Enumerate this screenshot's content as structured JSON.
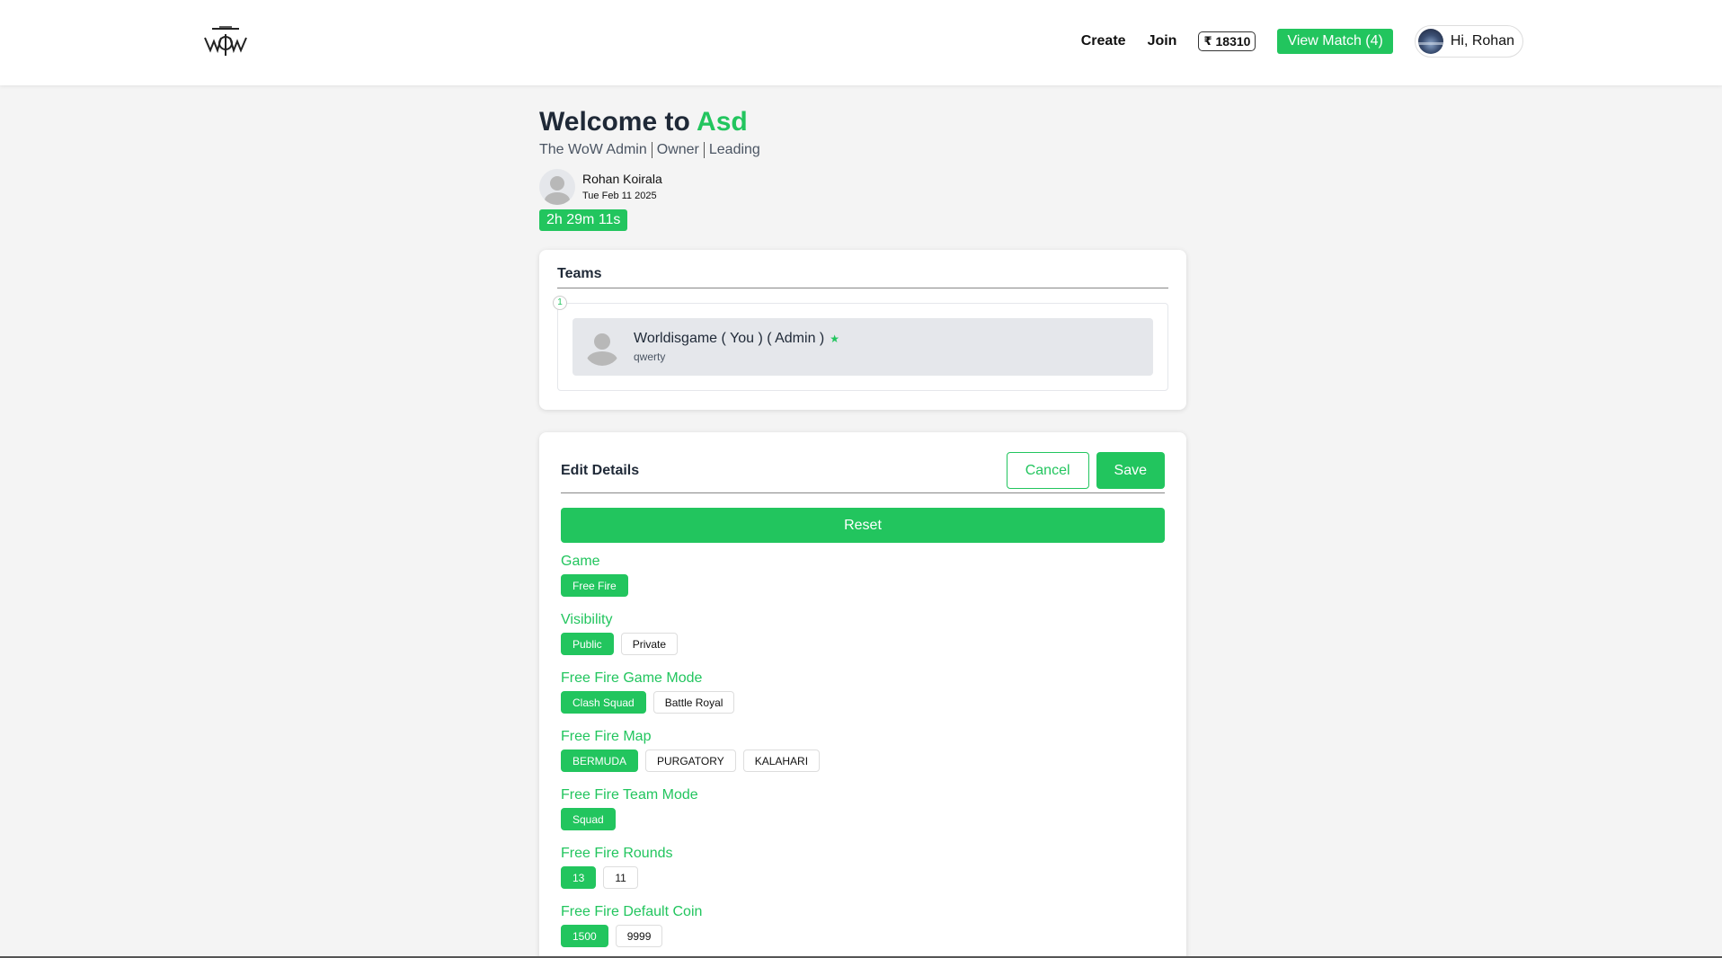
{
  "header": {
    "logo_text": "WOW",
    "nav": {
      "create": "Create",
      "join": "Join",
      "coin_symbol": "₹",
      "coins": "18310",
      "view_match": "View Match (4)",
      "greeting": "Hi, Rohan"
    }
  },
  "welcome": {
    "title_prefix": "Welcome to",
    "title_accent": "Asd",
    "roles": [
      "The WoW Admin",
      "Owner",
      "Leading"
    ],
    "creator_name": "Rohan Koirala",
    "creator_date": "Tue Feb 11 2025",
    "timer": "2h 29m 11s"
  },
  "teams": {
    "heading": "Teams",
    "items": [
      {
        "number": "1",
        "name": "Worldisgame ( You ) ( Admin )",
        "subtitle": "qwerty"
      }
    ]
  },
  "edit": {
    "heading": "Edit Details",
    "cancel": "Cancel",
    "save": "Save",
    "reset": "Reset",
    "fields": [
      {
        "label": "Game",
        "options": [
          "Free Fire"
        ],
        "selected": 0
      },
      {
        "label": "Visibility",
        "options": [
          "Public",
          "Private"
        ],
        "selected": 0
      },
      {
        "label": "Free Fire Game Mode",
        "options": [
          "Clash Squad",
          "Battle Royal"
        ],
        "selected": 0
      },
      {
        "label": "Free Fire Map",
        "options": [
          "BERMUDA",
          "PURGATORY",
          "KALAHARI"
        ],
        "selected": 0
      },
      {
        "label": "Free Fire Team Mode",
        "options": [
          "Squad"
        ],
        "selected": 0
      },
      {
        "label": "Free Fire Rounds",
        "options": [
          "13",
          "11"
        ],
        "selected": 0
      },
      {
        "label": "Free Fire Default Coin",
        "options": [
          "1500",
          "9999"
        ],
        "selected": 0
      }
    ]
  },
  "colors": {
    "accent": "#22c55e",
    "background": "#f4f4f4",
    "text_dark": "#1f2937"
  }
}
